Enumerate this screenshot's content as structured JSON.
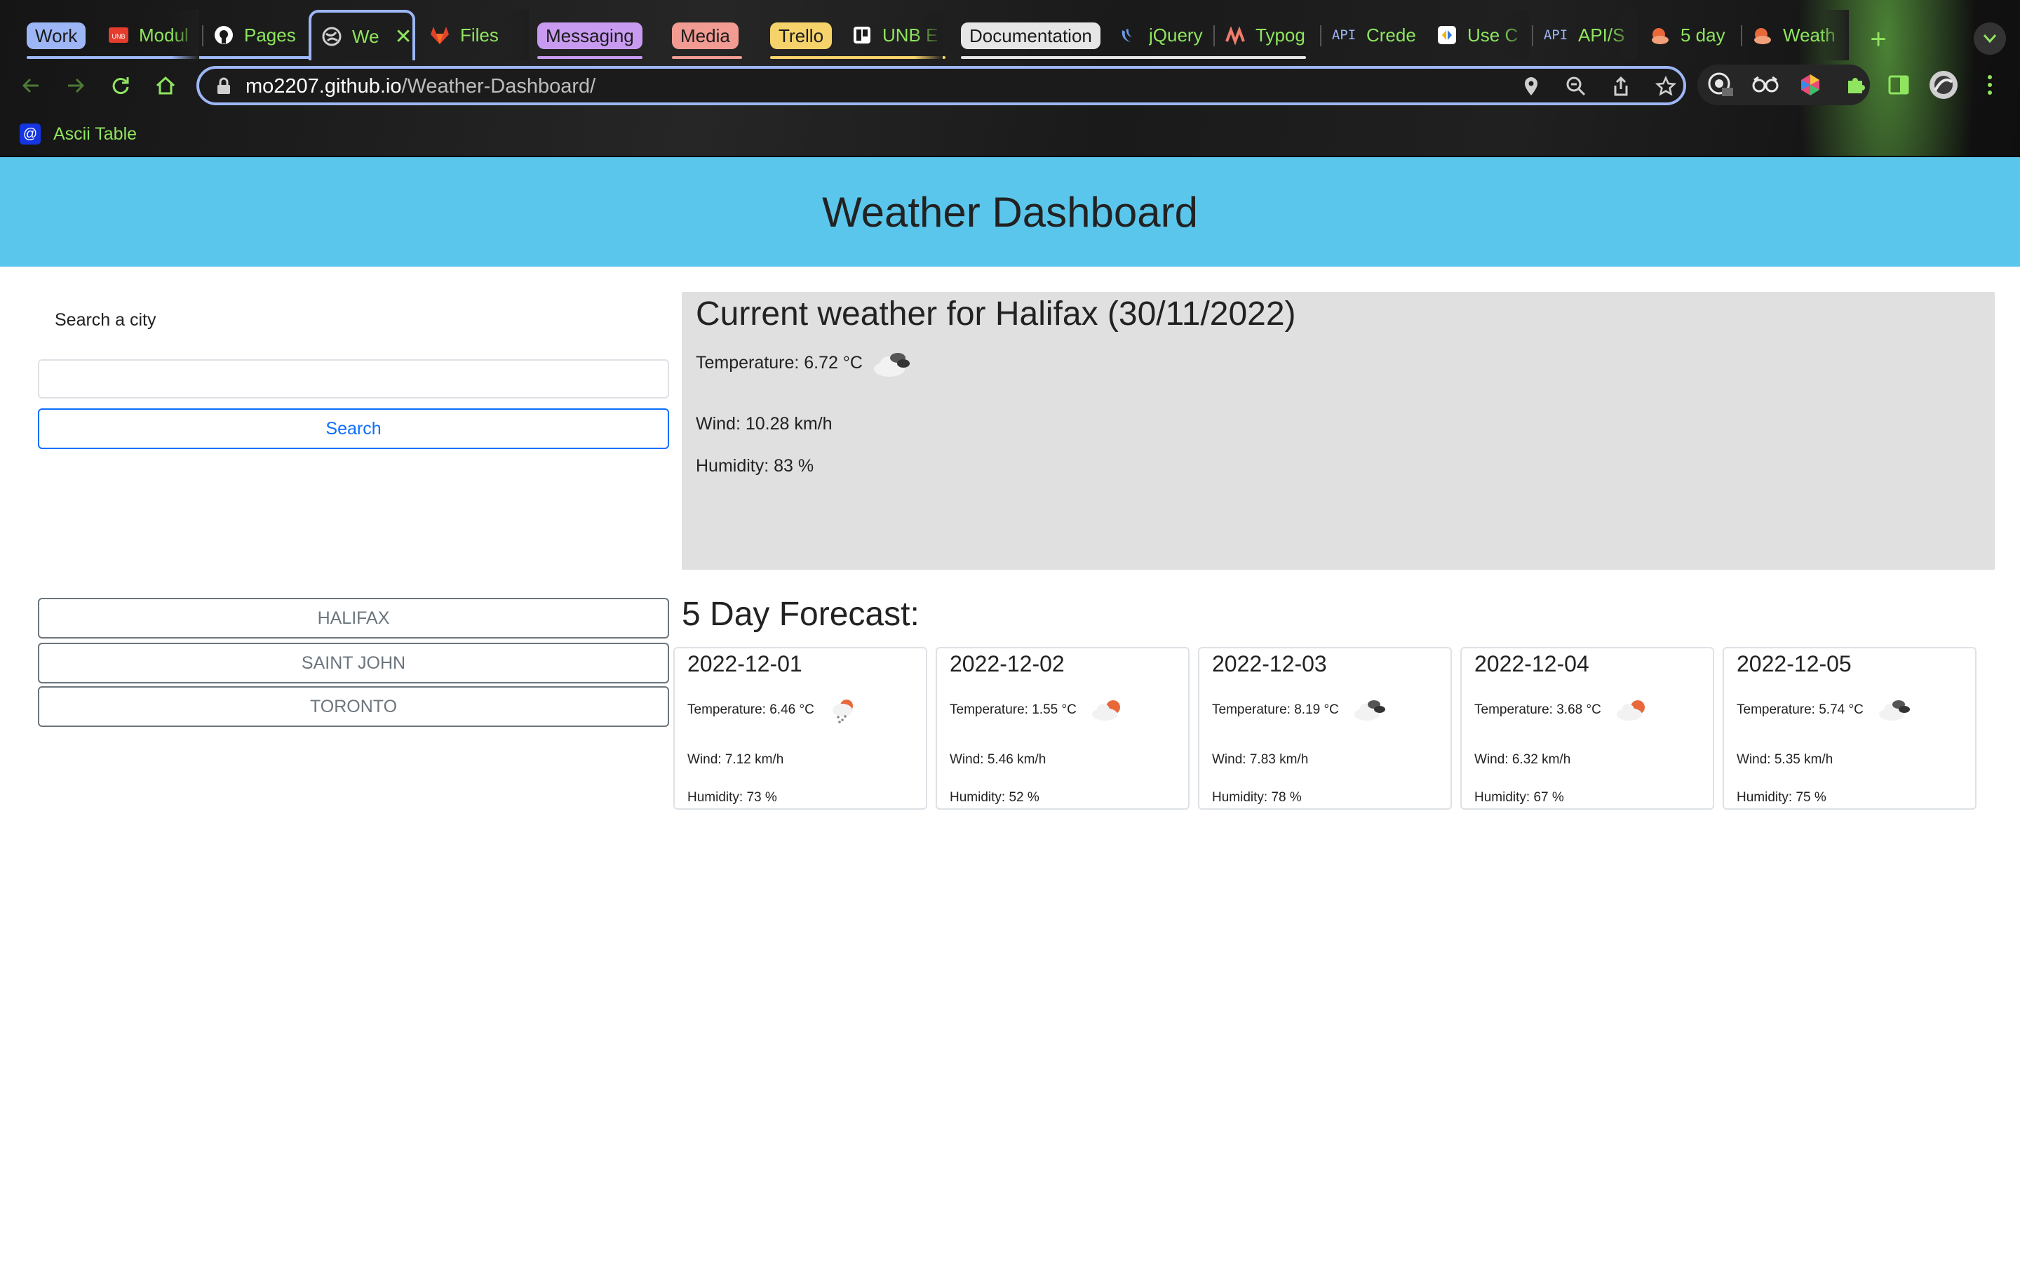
{
  "browser": {
    "tab_groups": [
      {
        "label": "Work",
        "bg": "#9db6f5",
        "fg": "#1b1b1b"
      },
      {
        "label": "Messaging",
        "bg": "#c89bf0",
        "fg": "#1b1b1b"
      },
      {
        "label": "Media",
        "bg": "#f29b93",
        "fg": "#1b1b1b"
      },
      {
        "label": "Trello",
        "bg": "#f6d36a",
        "fg": "#1b1b1b"
      },
      {
        "label": "Documentation",
        "bg": "#e6e6e6",
        "fg": "#1b1b1b"
      }
    ],
    "tabs": [
      {
        "title": "Modul"
      },
      {
        "title": "Pages"
      },
      {
        "title": "We"
      },
      {
        "title": "Files"
      },
      {
        "title": "UNB E"
      },
      {
        "title": "jQuery"
      },
      {
        "title": "Typog"
      },
      {
        "title": "Crede"
      },
      {
        "title": "Use C"
      },
      {
        "title": "API/S"
      },
      {
        "title": "5 day"
      },
      {
        "title": "Weath"
      }
    ],
    "api_badge": "API",
    "new_tab": "+",
    "url_host": "mo2207.github.io",
    "url_path": "/Weather-Dashboard/",
    "bookmarks": [
      {
        "label": "Ascii Table",
        "icon": "@"
      }
    ],
    "accent": "#8fe55f"
  },
  "page": {
    "title": "Weather Dashboard",
    "header_color": "#5bc6ec"
  },
  "search": {
    "label": "Search a city",
    "placeholder": "",
    "button": "Search"
  },
  "current": {
    "heading": "Current weather for Halifax (30/11/2022)",
    "temperature": "Temperature: 6.72 °C",
    "wind": "Wind: 10.28 km/h",
    "humidity": "Humidity: 83 %",
    "icon": "broken-clouds-icon"
  },
  "history": [
    "HALIFAX",
    "SAINT JOHN",
    "TORONTO"
  ],
  "forecast": {
    "title": "5 Day Forecast:",
    "days": [
      {
        "date": "2022-12-01",
        "temperature": "Temperature: 6.46 °C",
        "wind": "Wind: 7.12 km/h",
        "humidity": "Humidity: 73 %",
        "icon": "rain-sun-icon"
      },
      {
        "date": "2022-12-02",
        "temperature": "Temperature: 1.55 °C",
        "wind": "Wind: 5.46 km/h",
        "humidity": "Humidity: 52 %",
        "icon": "partly-cloudy-icon"
      },
      {
        "date": "2022-12-03",
        "temperature": "Temperature: 8.19 °C",
        "wind": "Wind: 7.83 km/h",
        "humidity": "Humidity: 78 %",
        "icon": "broken-clouds-icon"
      },
      {
        "date": "2022-12-04",
        "temperature": "Temperature: 3.68 °C",
        "wind": "Wind: 6.32 km/h",
        "humidity": "Humidity: 67 %",
        "icon": "partly-cloudy-icon"
      },
      {
        "date": "2022-12-05",
        "temperature": "Temperature: 5.74 °C",
        "wind": "Wind: 5.35 km/h",
        "humidity": "Humidity: 75 %",
        "icon": "broken-clouds-icon"
      }
    ]
  }
}
